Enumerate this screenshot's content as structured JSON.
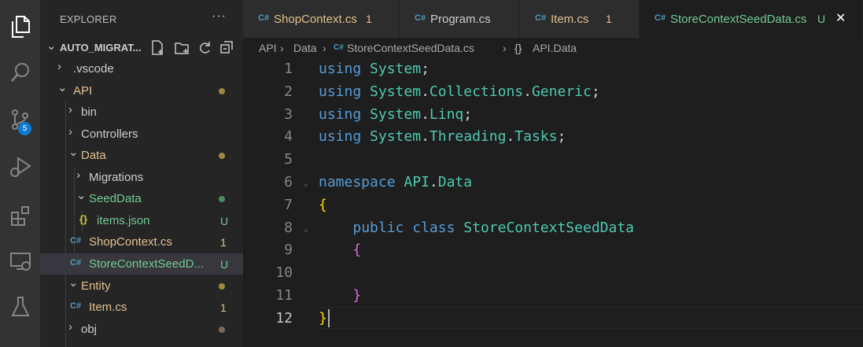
{
  "sidebar": {
    "title": "EXPLORER",
    "more": "···",
    "project_name": "AUTO_MIGRAT...",
    "items": [
      {
        "label": ".vscode",
        "kind": "folder",
        "expanded": false,
        "color": "#cccccc"
      },
      {
        "label": "API",
        "kind": "folder",
        "expanded": true,
        "color": "#e2c08d",
        "dot": "#a08a3e"
      },
      {
        "label": "bin",
        "kind": "folder",
        "expanded": false,
        "color": "#cccccc"
      },
      {
        "label": "Controllers",
        "kind": "folder",
        "expanded": false,
        "color": "#cccccc"
      },
      {
        "label": "Data",
        "kind": "folder",
        "expanded": true,
        "color": "#e2c08d",
        "dot": "#a08a3e"
      },
      {
        "label": "Migrations",
        "kind": "folder",
        "expanded": false,
        "color": "#cccccc"
      },
      {
        "label": "SeedData",
        "kind": "folder",
        "expanded": true,
        "color": "#73c991",
        "dot": "#4e8a63"
      },
      {
        "label": "items.json",
        "kind": "json-file",
        "icon": "{}",
        "color": "#73c991",
        "status": "U"
      },
      {
        "label": "ShopContext.cs",
        "kind": "cs-file",
        "icon": "C#",
        "color": "#e2c08d",
        "status": "1"
      },
      {
        "label": "StoreContextSeedD...",
        "kind": "cs-file",
        "icon": "C#",
        "color": "#73c991",
        "status": "U"
      },
      {
        "label": "Entity",
        "kind": "folder",
        "expanded": true,
        "color": "#e2c08d",
        "dot": "#a08a3e"
      },
      {
        "label": "Item.cs",
        "kind": "cs-file",
        "icon": "C#",
        "color": "#e2c08d",
        "status": "1"
      },
      {
        "label": "obj",
        "kind": "folder",
        "expanded": false,
        "color": "#cccccc",
        "dot": "#7a6a5a"
      }
    ]
  },
  "activity": {
    "scm_badge": "5"
  },
  "tabs": [
    {
      "icon": "C#",
      "label": "ShopContext.cs",
      "status": "1",
      "color": "#e2c08d"
    },
    {
      "icon": "C#",
      "label": "Program.cs",
      "status": "",
      "color": "#cccccc"
    },
    {
      "icon": "C#",
      "label": "Item.cs",
      "status": "1",
      "color": "#e2c08d"
    },
    {
      "icon": "C#",
      "label": "StoreContextSeedData.cs",
      "status": "U",
      "color": "#73c991",
      "active": true,
      "close": "✕"
    }
  ],
  "breadcrumb": {
    "part1": "API",
    "sep": "›",
    "part2": "Data",
    "file_icon": "C#",
    "part3": "StoreContextSeedData.cs",
    "ns_icon": "{}",
    "part4": "API.Data"
  },
  "editor": {
    "current_line": 12,
    "lines": [
      {
        "n": "1",
        "tokens": [
          [
            "kw",
            "using"
          ],
          [
            "pl",
            " "
          ],
          [
            "ns",
            "System"
          ],
          [
            "pl",
            ";"
          ]
        ]
      },
      {
        "n": "2",
        "tokens": [
          [
            "kw",
            "using"
          ],
          [
            "pl",
            " "
          ],
          [
            "ns",
            "System"
          ],
          [
            "pl",
            "."
          ],
          [
            "ns",
            "Collections"
          ],
          [
            "pl",
            "."
          ],
          [
            "ns",
            "Generic"
          ],
          [
            "pl",
            ";"
          ]
        ]
      },
      {
        "n": "3",
        "tokens": [
          [
            "kw",
            "using"
          ],
          [
            "pl",
            " "
          ],
          [
            "ns",
            "System"
          ],
          [
            "pl",
            "."
          ],
          [
            "ns",
            "Linq"
          ],
          [
            "pl",
            ";"
          ]
        ]
      },
      {
        "n": "4",
        "tokens": [
          [
            "kw",
            "using"
          ],
          [
            "pl",
            " "
          ],
          [
            "ns",
            "System"
          ],
          [
            "pl",
            "."
          ],
          [
            "ns",
            "Threading"
          ],
          [
            "pl",
            "."
          ],
          [
            "ns",
            "Tasks"
          ],
          [
            "pl",
            ";"
          ]
        ]
      },
      {
        "n": "5",
        "tokens": []
      },
      {
        "n": "6",
        "tokens": [
          [
            "kw",
            "namespace"
          ],
          [
            "pl",
            " "
          ],
          [
            "ns",
            "API"
          ],
          [
            "pl",
            "."
          ],
          [
            "ns",
            "Data"
          ]
        ]
      },
      {
        "n": "7",
        "tokens": [
          [
            "br1",
            "{"
          ]
        ]
      },
      {
        "n": "8",
        "tokens": [
          [
            "pl",
            "    "
          ],
          [
            "kw2",
            "public"
          ],
          [
            "pl",
            " "
          ],
          [
            "kw2",
            "class"
          ],
          [
            "pl",
            " "
          ],
          [
            "ns",
            "StoreContextSeedData"
          ]
        ]
      },
      {
        "n": "9",
        "tokens": [
          [
            "pl",
            "    "
          ],
          [
            "br2",
            "{"
          ]
        ]
      },
      {
        "n": "10",
        "tokens": []
      },
      {
        "n": "11",
        "tokens": [
          [
            "pl",
            "    "
          ],
          [
            "br2",
            "}"
          ]
        ]
      },
      {
        "n": "12",
        "tokens": [
          [
            "br1",
            "}"
          ]
        ]
      }
    ]
  }
}
